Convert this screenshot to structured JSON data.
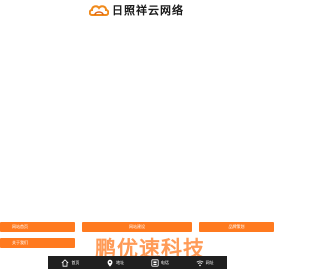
{
  "brand": {
    "name": "日照祥云网络"
  },
  "menu": {
    "buttons": [
      {
        "label": "网站首页"
      },
      {
        "label": "网站建设"
      },
      {
        "label": "品牌策划"
      },
      {
        "label": "关于我们"
      }
    ]
  },
  "watermark": {
    "text": "鹏优速科技"
  },
  "tabbar": {
    "tabs": [
      {
        "label": "首页",
        "icon": "home-icon"
      },
      {
        "label": "地址",
        "icon": "location-pin-icon"
      },
      {
        "label": "电话",
        "icon": "phone-icon"
      },
      {
        "label": "网址",
        "icon": "wifi-icon"
      }
    ]
  },
  "colors": {
    "accent": "#ff7a1f",
    "tabbar_bg": "#1f1f1f"
  }
}
